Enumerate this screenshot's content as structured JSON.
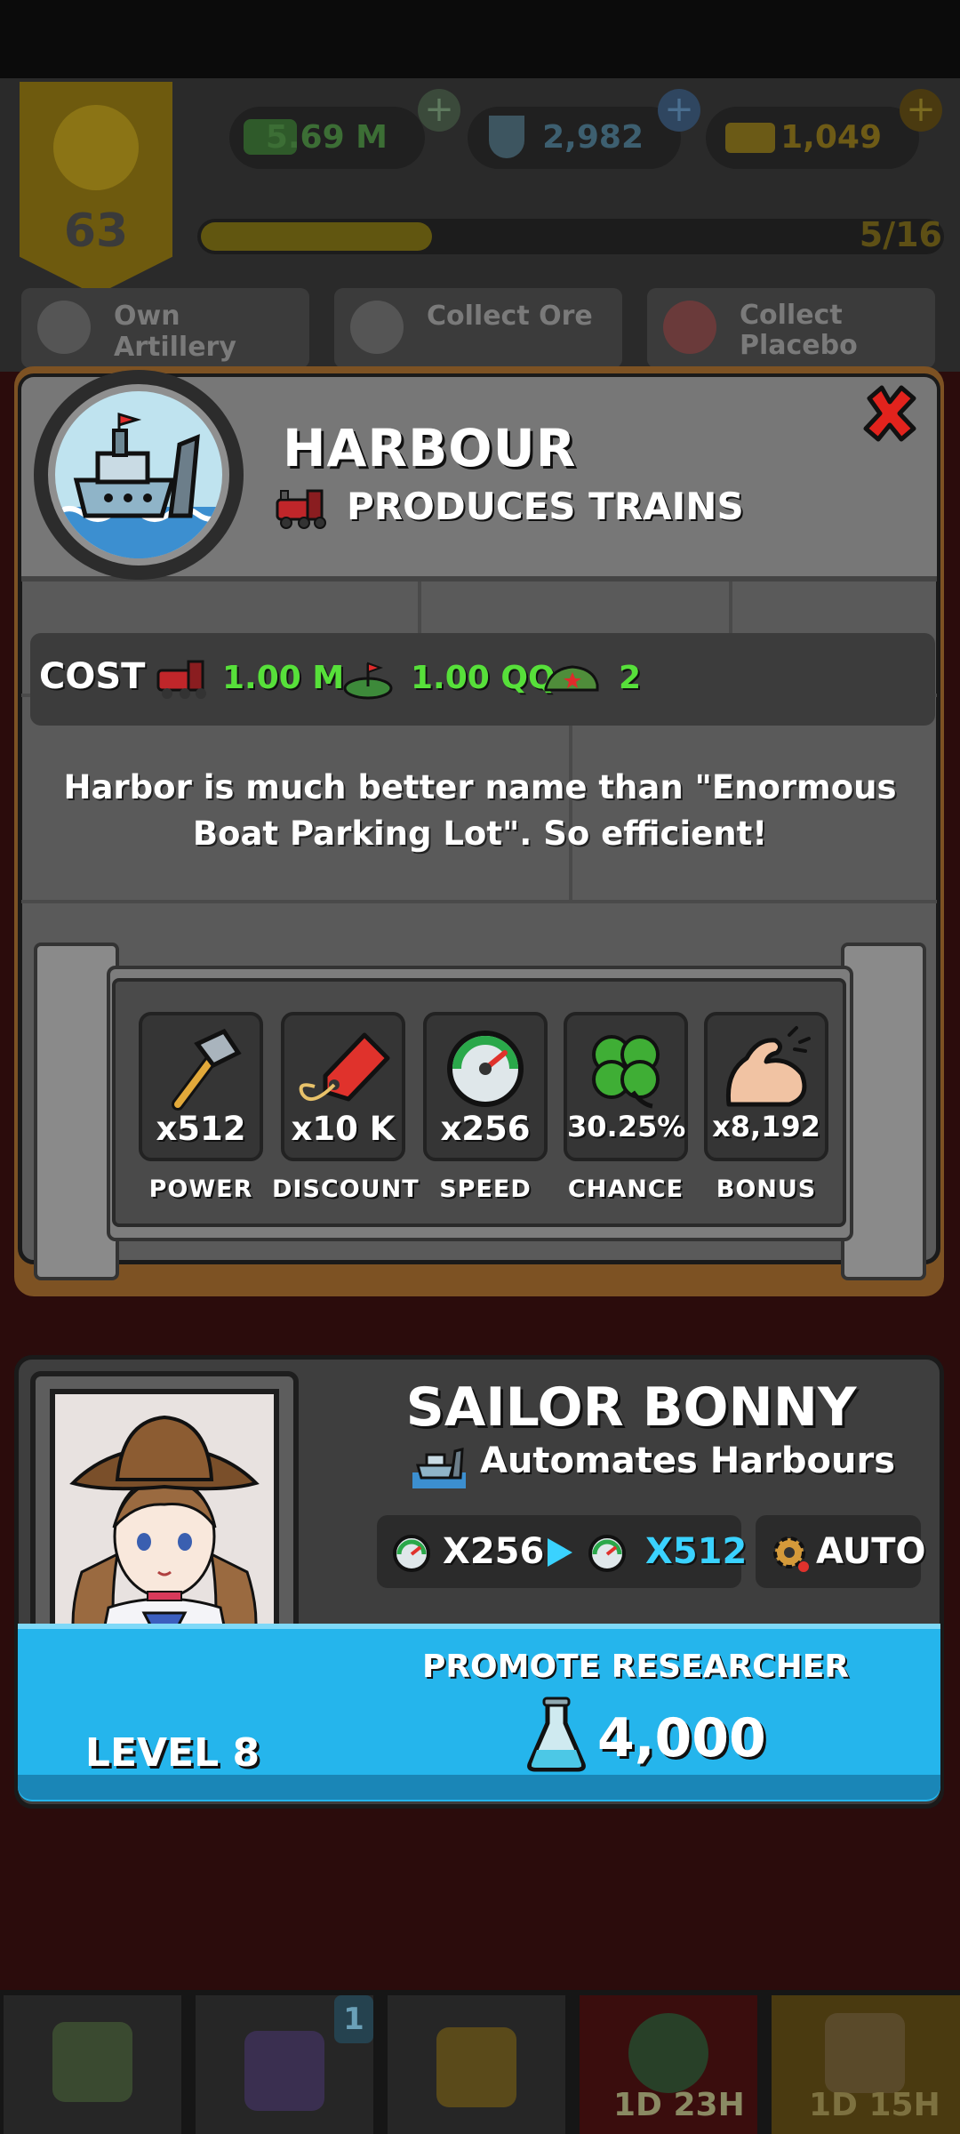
{
  "hud": {
    "level": "63",
    "resources": [
      {
        "icon": "cash-icon",
        "value": "5.69 M"
      },
      {
        "icon": "flask-icon",
        "value": "2,982"
      },
      {
        "icon": "gold-bars-icon",
        "value": "1,049"
      }
    ],
    "progress": {
      "text": "5/16",
      "fraction": 0.3125
    },
    "quests": [
      {
        "icon": "artillery-icon",
        "label": "Own Artillery"
      },
      {
        "icon": "ore-icon",
        "label": "Collect Ore"
      },
      {
        "icon": "pill-icon",
        "label": "Collect Placebo"
      }
    ]
  },
  "building": {
    "title": "HARBOUR",
    "subtitle": "PRODUCES TRAINS",
    "cost_label": "COST",
    "costs": [
      {
        "icon": "train-icon",
        "value": "1.00 M"
      },
      {
        "icon": "land-icon",
        "value": "1.00 QQ"
      },
      {
        "icon": "army-cap-icon",
        "value": "2"
      }
    ],
    "description": "Harbor is much better name than \"Enormous Boat Parking Lot\". So efficient!",
    "stats": [
      {
        "icon": "hammer-icon",
        "value": "x512",
        "label": "POWER"
      },
      {
        "icon": "price-tag-icon",
        "value": "x10 K",
        "label": "DISCOUNT"
      },
      {
        "icon": "speedometer-icon",
        "value": "x256",
        "label": "SPEED"
      },
      {
        "icon": "clover-icon",
        "value": "30.25%",
        "label": "CHANCE"
      },
      {
        "icon": "bicep-icon",
        "value": "x8,192",
        "label": "BONUS"
      }
    ]
  },
  "researcher": {
    "name": "SAILOR BONNY",
    "role": "Automates Harbours",
    "speed_from": "X256",
    "speed_to": "X512",
    "auto_label": "AUTO",
    "level_label": "LEVEL 8",
    "promote_label": "PROMOTE RESEARCHER",
    "promote_cost": "4,000"
  },
  "bottom_nav": {
    "badge": "1",
    "timers": [
      "1D 23H",
      "1D 15H"
    ]
  },
  "colors": {
    "cost_green": "#57e03a",
    "promote_blue": "#25b5ec",
    "speed_cyan": "#3ad2ff",
    "close_red": "#e2231d"
  }
}
